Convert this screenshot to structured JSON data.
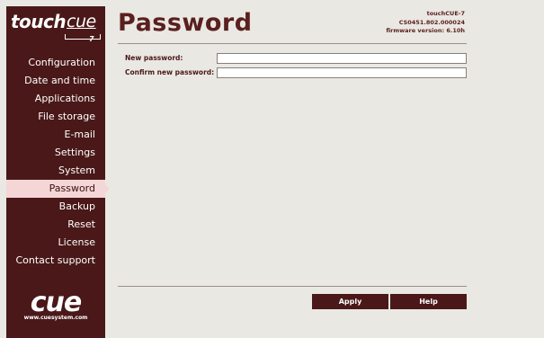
{
  "logo": {
    "brand_left": "touch",
    "brand_right": "cue",
    "brand_number": "7",
    "bottom_logo": "cue",
    "url": "www.cuesystem.com"
  },
  "sidebar": {
    "items": [
      {
        "label": "Configuration",
        "active": false
      },
      {
        "label": "Date and time",
        "active": false
      },
      {
        "label": "Applications",
        "active": false
      },
      {
        "label": "File storage",
        "active": false
      },
      {
        "label": "E-mail",
        "active": false
      },
      {
        "label": "Settings",
        "active": false
      },
      {
        "label": "System",
        "active": false
      },
      {
        "label": "Password",
        "active": true
      },
      {
        "label": "Backup",
        "active": false
      },
      {
        "label": "Reset",
        "active": false
      },
      {
        "label": "License",
        "active": false
      },
      {
        "label": "Contact support",
        "active": false
      }
    ]
  },
  "header": {
    "title": "Password",
    "device_name": "touchCUE-7",
    "device_id": "CS0451.802.000024",
    "firmware": "firmware version: 6.10h"
  },
  "form": {
    "new_password_label": "New password:",
    "new_password_value": "",
    "confirm_password_label": "Confirm new password:",
    "confirm_password_value": ""
  },
  "buttons": {
    "apply": "Apply",
    "help": "Help"
  },
  "colors": {
    "sidebar_bg": "#4a1818",
    "accent": "#5a1f1f",
    "active_item": "#f5d6d6",
    "page_bg": "#eae8e3"
  }
}
